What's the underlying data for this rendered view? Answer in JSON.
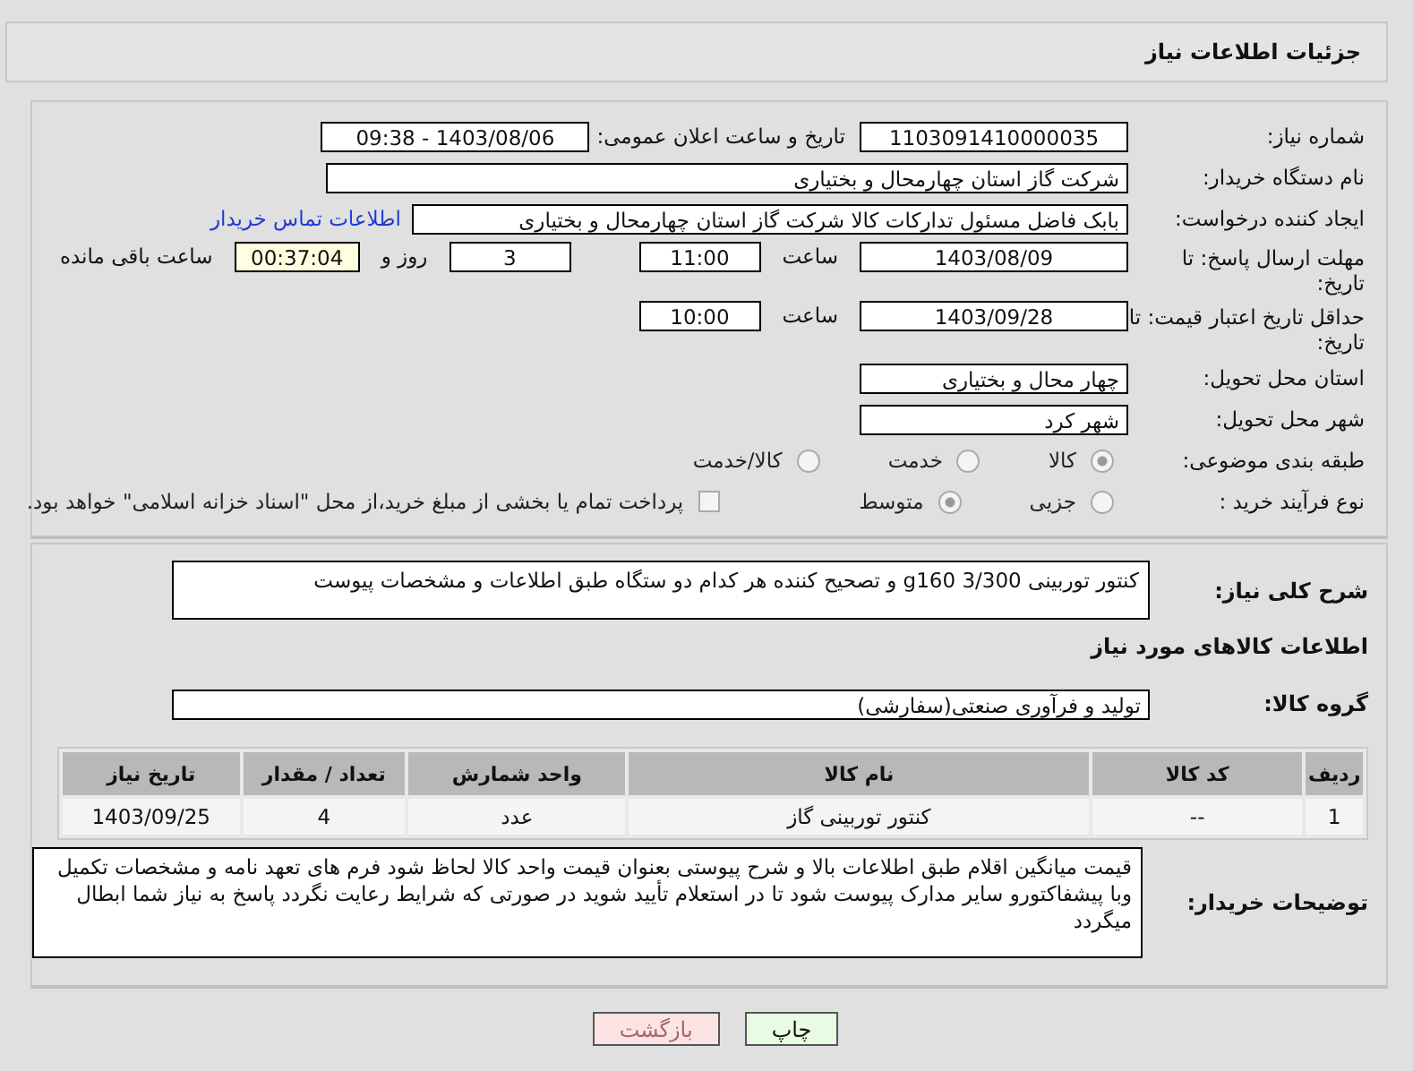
{
  "header": {
    "title": "جزئیات اطلاعات نیاز"
  },
  "need_number": {
    "label": "شماره نیاز:",
    "value": "1103091410000035"
  },
  "announce": {
    "label": "تاریخ و ساعت اعلان عمومی:",
    "value": "1403/08/06 - 09:38"
  },
  "buyer_org": {
    "label": "نام دستگاه خریدار:",
    "value": "شرکت گاز استان چهارمحال و بختیاری"
  },
  "requester": {
    "label": "ایجاد کننده درخواست:",
    "value": "بابک فاضل  مسئول تدارکات کالا شرکت گاز استان چهارمحال و بختیاری",
    "link": "اطلاعات تماس خریدار"
  },
  "deadline": {
    "label": "مهلت ارسال پاسخ: تا تاریخ:",
    "date": "1403/08/09",
    "time_label": "ساعت",
    "time": "11:00",
    "days": "3",
    "days_label": "روز و",
    "remaining": "00:37:04",
    "remaining_label": "ساعت باقی مانده"
  },
  "validity": {
    "label": "حداقل تاریخ اعتبار قیمت: تا تاریخ:",
    "date": "1403/09/28",
    "time_label": "ساعت",
    "time": "10:00"
  },
  "province": {
    "label": "استان محل تحویل:",
    "value": "چهار محال و بختیاری"
  },
  "city": {
    "label": "شهر محل تحویل:",
    "value": "شهر کرد"
  },
  "category": {
    "label": "طبقه بندی موضوعی:",
    "options": [
      {
        "label": "کالا",
        "selected": true
      },
      {
        "label": "خدمت",
        "selected": false
      },
      {
        "label": "کالا/خدمت",
        "selected": false
      }
    ]
  },
  "process": {
    "label": "نوع فرآیند خرید :",
    "options": [
      {
        "label": "جزیی",
        "selected": false
      },
      {
        "label": "متوسط",
        "selected": true
      }
    ],
    "treasury": {
      "label": "پرداخت تمام یا بخشی از مبلغ خرید،از محل \"اسناد خزانه اسلامی\" خواهد بود.",
      "checked": false
    }
  },
  "summary": {
    "label": "شرح کلی نیاز:",
    "value": "کنتور توربینی g160 3/300 و تصحیح کننده هر کدام دو ستگاه طبق اطلاعات و مشخصات پیوست"
  },
  "items_title": "اطلاعات کالاهای مورد نیاز",
  "goods_group": {
    "label": "گروه کالا:",
    "value": "تولید و فرآوری صنعتی(سفارشی)"
  },
  "table": {
    "columns": [
      "ردیف",
      "کد کالا",
      "نام کالا",
      "واحد شمارش",
      "تعداد / مقدار",
      "تاریخ نیاز"
    ],
    "rows": [
      [
        "1",
        "--",
        "کنتور توربینی گاز",
        "عدد",
        "4",
        "1403/09/25"
      ]
    ]
  },
  "notes": {
    "label": "توضیحات خریدار:",
    "value": "قیمت میانگین اقلام طبق اطلاعات بالا و شرح پیوستی بعنوان قیمت واحد  کالا  لحاظ شود فرم های تعهد نامه و مشخصات تکمیل وبا پیشفاکتورو سایر مدارک پیوست شود تا در استعلام تأیید شوید در صورتی که شرایط رعایت نگردد پاسخ به نیاز شما ابطال میگردد"
  },
  "buttons": [
    {
      "label": "چاپ",
      "kind": "print"
    },
    {
      "label": "بازگشت",
      "kind": "back"
    }
  ]
}
